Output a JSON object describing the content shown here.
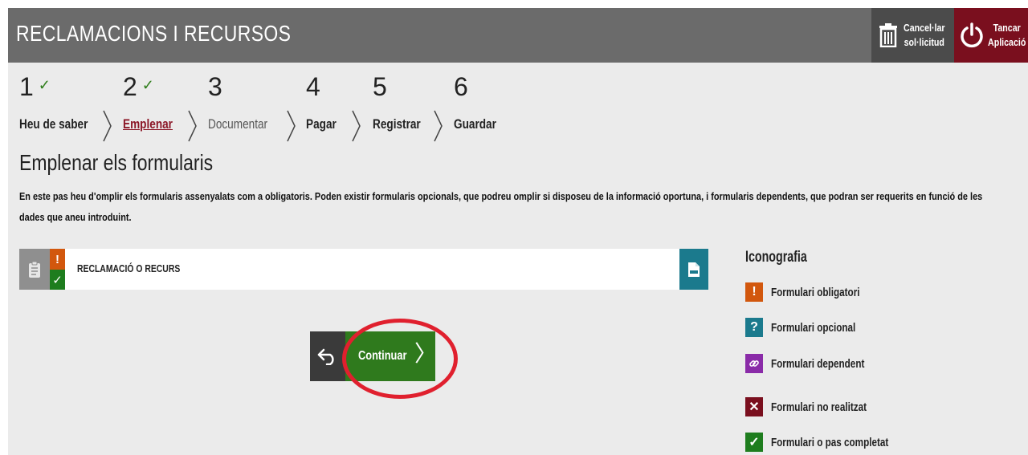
{
  "header": {
    "title": "RECLAMACIONS I RECURSOS",
    "cancel_label_line1": "Cancel·lar",
    "cancel_label_line2": "sol·licitud",
    "close_label_line1": "Tancar",
    "close_label_line2": "Aplicació"
  },
  "steps": [
    {
      "number": "1",
      "label": "Heu de saber",
      "completed": true
    },
    {
      "number": "2",
      "label": "Emplenar",
      "completed": true,
      "active": true
    },
    {
      "number": "3",
      "label": "Documentar",
      "completed": false
    },
    {
      "number": "4",
      "label": "Pagar",
      "completed": false
    },
    {
      "number": "5",
      "label": "Registrar",
      "completed": false
    },
    {
      "number": "6",
      "label": "Guardar",
      "completed": false
    }
  ],
  "check_glyph": "✓",
  "section": {
    "title": "Emplenar els formularis",
    "intro": "En este pas heu d'omplir els formularis assenyalats com a obligatoris. Poden existir formularis opcionals, que podreu omplir si disposeu de la informació oportuna, i formularis dependents, que podran ser requerits en funció de les dades que aneu introduint."
  },
  "form": {
    "name": "RECLAMACIÓ O RECURS",
    "status_mandatory_glyph": "!",
    "status_done_glyph": "✓"
  },
  "buttons": {
    "continue_label": "Continuar",
    "continue_chevron": "〉"
  },
  "legend": {
    "title": "Iconografia",
    "items": [
      {
        "glyph": "!",
        "label": "Formulari obligatori",
        "color": "#d2570d"
      },
      {
        "glyph": "?",
        "label": "Formulari opcional",
        "color": "#1b7a8d"
      },
      {
        "glyph": "🔗",
        "label": "Formulari dependent",
        "color": "#8a2ba8"
      },
      {
        "glyph": "✕",
        "label": "Formulari no realitzat",
        "color": "#7a0f1e"
      },
      {
        "glyph": "✓",
        "label": "Formulari o pas completat",
        "color": "#1e7d1e"
      }
    ]
  },
  "colors": {
    "header_bg": "#6b6b6b",
    "active_step": "#8b1626",
    "continue_bg": "#2f7a1d",
    "highlight": "#e0202e"
  }
}
